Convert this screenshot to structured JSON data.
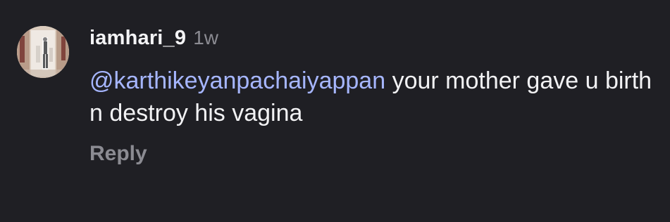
{
  "comment": {
    "avatar_icon": "profile-photo-avatar",
    "username": "iamhari_9",
    "timestamp": "1w",
    "mention": "@karthikeyanpachaiyappan",
    "text": " your mother gave u birth n destroy his vagina",
    "reply_label": "Reply"
  },
  "colors": {
    "background": "#1f1f24",
    "username": "#f4f4f6",
    "muted": "#8b8b92",
    "mention": "#a6b6ff"
  }
}
